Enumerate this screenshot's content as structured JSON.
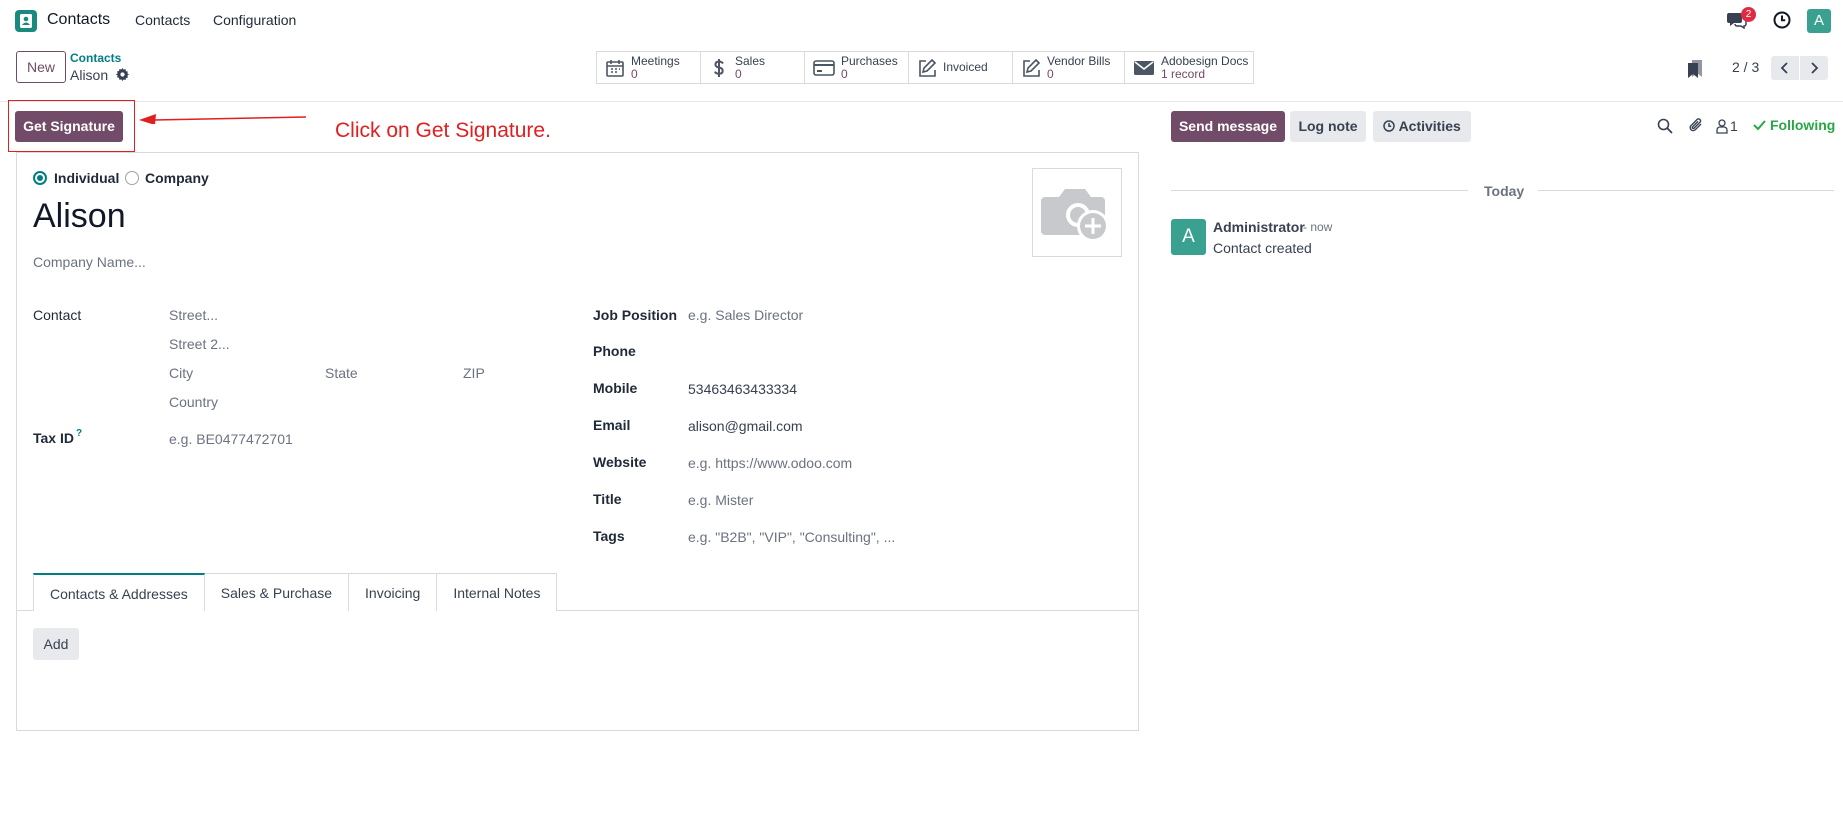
{
  "navbar": {
    "app_name": "Contacts",
    "menu": [
      "Contacts",
      "Configuration"
    ],
    "chat_badge": "2",
    "avatar_letter": "A"
  },
  "control_panel": {
    "new_label": "New",
    "breadcrumb_parent": "Contacts",
    "breadcrumb_current": "Alison",
    "pager": "2 / 3"
  },
  "smart_buttons": [
    {
      "label": "Meetings",
      "value": "0",
      "icon": "calendar-icon"
    },
    {
      "label": "Sales",
      "value": "0",
      "icon": "dollar-icon"
    },
    {
      "label": "Purchases",
      "value": "0",
      "icon": "credit-card-icon"
    },
    {
      "label": "Invoiced",
      "value": "",
      "icon": "pencil-square-icon"
    },
    {
      "label": "Vendor Bills",
      "value": "0",
      "icon": "pencil-square-icon"
    },
    {
      "label": "Adobesign Docs",
      "value": "1 record",
      "icon": "envelope-icon"
    }
  ],
  "actions": {
    "get_signature": "Get Signature",
    "annotation": "Click on Get Signature."
  },
  "form": {
    "type_individual": "Individual",
    "type_company": "Company",
    "name": "Alison",
    "company_placeholder": "Company Name...",
    "left": {
      "contact_label": "Contact",
      "street_placeholder": "Street...",
      "street2_placeholder": "Street 2...",
      "city_placeholder": "City",
      "state_placeholder": "State",
      "zip_placeholder": "ZIP",
      "country_placeholder": "Country",
      "taxid_label": "Tax ID",
      "taxid_help": "?",
      "taxid_placeholder": "e.g. BE0477472701"
    },
    "right": {
      "job_label": "Job Position",
      "job_placeholder": "e.g. Sales Director",
      "phone_label": "Phone",
      "mobile_label": "Mobile",
      "mobile_value": "53463463433334",
      "email_label": "Email",
      "email_value": "alison@gmail.com",
      "website_label": "Website",
      "website_placeholder": "e.g. https://www.odoo.com",
      "title_label": "Title",
      "title_placeholder": "e.g. Mister",
      "tags_label": "Tags",
      "tags_placeholder": "e.g. \"B2B\", \"VIP\", \"Consulting\", ..."
    },
    "tabs": [
      "Contacts & Addresses",
      "Sales & Purchase",
      "Invoicing",
      "Internal Notes"
    ],
    "add_label": "Add"
  },
  "chatter": {
    "send_message": "Send message",
    "log_note": "Log note",
    "activities": "Activities",
    "followers_count": "1",
    "following": "Following",
    "date_separator": "Today",
    "message": {
      "author": "Administrator",
      "time": "- now",
      "body": "Contact created",
      "avatar_letter": "A"
    }
  },
  "colors": {
    "brand": "#714b67",
    "teal": "#017e84",
    "annotation": "#e02020",
    "success": "#28a745"
  }
}
